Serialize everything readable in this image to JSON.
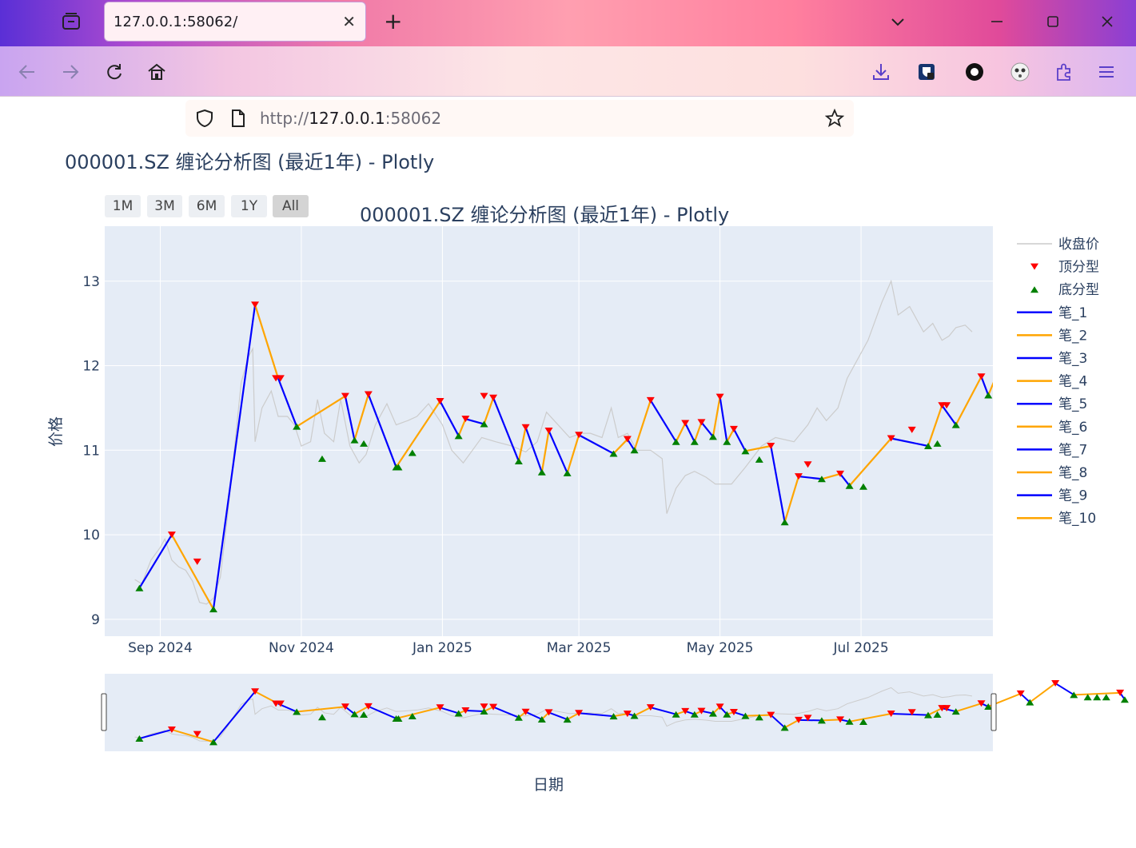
{
  "browser": {
    "tab_title": "127.0.0.1:58062/",
    "tab_close": "✕",
    "new_tab": "+",
    "url_scheme": "http://",
    "url_host": "127.0.0.1",
    "url_port": ":58062"
  },
  "page": {
    "title": "000001.SZ 缠论分析图 (最近1年) - Plotly"
  },
  "range_buttons": [
    "1M",
    "3M",
    "6M",
    "1Y",
    "All"
  ],
  "range_active": "All",
  "colors": {
    "plot_bg": "#e5ecf6",
    "close": "#cccccc",
    "top": "#ff0000",
    "bottom": "#008000",
    "bi_odd": "#0000ff",
    "bi_even": "#ffa500",
    "text": "#2a3f5f"
  },
  "chart_data": {
    "type": "line",
    "title": "000001.SZ 缠论分析图 (最近1年) - Plotly",
    "xlabel": "日期",
    "ylabel": "价格",
    "x_ticks": [
      "Sep 2024",
      "Nov 2024",
      "Jan 2025",
      "Mar 2025",
      "May 2025",
      "Jul 2025"
    ],
    "x_tick_dates": [
      "2024-09-01",
      "2024-11-01",
      "2025-01-01",
      "2025-03-01",
      "2025-05-01",
      "2025-07-01"
    ],
    "y_ticks": [
      9,
      10,
      11,
      12,
      13
    ],
    "xlim": [
      "2024-08-08",
      "2025-08-27"
    ],
    "ylim": [
      8.8,
      13.65
    ],
    "legend": [
      "收盘价",
      "顶分型",
      "底分型",
      "笔_1",
      "笔_2",
      "笔_3",
      "笔_4",
      "笔_5",
      "笔_6",
      "笔_7",
      "笔_8",
      "笔_9",
      "笔_10"
    ],
    "legend_position": "right",
    "close": [
      [
        "2024-08-21",
        9.47
      ],
      [
        "2024-08-24",
        9.42
      ],
      [
        "2024-08-28",
        9.7
      ],
      [
        "2024-09-01",
        9.85
      ],
      [
        "2024-09-03",
        9.95
      ],
      [
        "2024-09-06",
        9.7
      ],
      [
        "2024-09-09",
        9.62
      ],
      [
        "2024-09-12",
        9.58
      ],
      [
        "2024-09-15",
        9.45
      ],
      [
        "2024-09-18",
        9.2
      ],
      [
        "2024-09-21",
        9.18
      ],
      [
        "2024-09-24",
        9.25
      ],
      [
        "2024-09-27",
        9.5
      ],
      [
        "2024-09-30",
        10.2
      ],
      [
        "2024-10-03",
        11.0
      ],
      [
        "2024-10-06",
        11.8
      ],
      [
        "2024-10-09",
        12.1
      ],
      [
        "2024-10-11",
        12.2
      ],
      [
        "2024-10-12",
        11.1
      ],
      [
        "2024-10-15",
        11.5
      ],
      [
        "2024-10-19",
        11.7
      ],
      [
        "2024-10-22",
        11.4
      ],
      [
        "2024-10-26",
        11.4
      ],
      [
        "2024-10-29",
        11.3
      ],
      [
        "2024-11-01",
        11.05
      ],
      [
        "2024-11-05",
        11.1
      ],
      [
        "2024-11-08",
        11.6
      ],
      [
        "2024-11-11",
        11.2
      ],
      [
        "2024-11-15",
        11.1
      ],
      [
        "2024-11-18",
        11.6
      ],
      [
        "2024-11-22",
        11.05
      ],
      [
        "2024-11-26",
        10.85
      ],
      [
        "2024-11-29",
        10.95
      ],
      [
        "2024-12-03",
        11.3
      ],
      [
        "2024-12-08",
        11.55
      ],
      [
        "2024-12-12",
        11.3
      ],
      [
        "2024-12-17",
        11.35
      ],
      [
        "2024-12-21",
        11.4
      ],
      [
        "2024-12-26",
        11.55
      ],
      [
        "2025-01-01",
        11.3
      ],
      [
        "2025-01-05",
        11.0
      ],
      [
        "2025-01-10",
        10.85
      ],
      [
        "2025-01-14",
        11.0
      ],
      [
        "2025-01-18",
        11.15
      ],
      [
        "2025-01-24",
        11.1
      ],
      [
        "2025-01-31",
        11.05
      ],
      [
        "2025-02-06",
        10.98
      ],
      [
        "2025-02-11",
        11.1
      ],
      [
        "2025-02-15",
        11.45
      ],
      [
        "2025-02-20",
        11.3
      ],
      [
        "2025-02-25",
        11.15
      ],
      [
        "2025-03-02",
        11.2
      ],
      [
        "2025-03-06",
        11.2
      ],
      [
        "2025-03-11",
        11.15
      ],
      [
        "2025-03-15",
        11.5
      ],
      [
        "2025-03-18",
        11.15
      ],
      [
        "2025-03-22",
        11.2
      ],
      [
        "2025-03-26",
        11.0
      ],
      [
        "2025-04-01",
        11.0
      ],
      [
        "2025-04-06",
        10.9
      ],
      [
        "2025-04-08",
        10.25
      ],
      [
        "2025-04-12",
        10.55
      ],
      [
        "2025-04-16",
        10.7
      ],
      [
        "2025-04-20",
        10.75
      ],
      [
        "2025-04-25",
        10.68
      ],
      [
        "2025-04-29",
        10.6
      ],
      [
        "2025-05-06",
        10.6
      ],
      [
        "2025-05-12",
        10.8
      ],
      [
        "2025-05-19",
        11.05
      ],
      [
        "2025-05-25",
        11.15
      ],
      [
        "2025-06-02",
        11.1
      ],
      [
        "2025-06-08",
        11.3
      ],
      [
        "2025-06-12",
        11.5
      ],
      [
        "2025-06-16",
        11.35
      ],
      [
        "2025-06-21",
        11.5
      ],
      [
        "2025-06-25",
        11.85
      ],
      [
        "2025-06-30",
        12.1
      ],
      [
        "2025-07-04",
        12.3
      ],
      [
        "2025-07-10",
        12.75
      ],
      [
        "2025-07-14",
        13.0
      ],
      [
        "2025-07-17",
        12.6
      ],
      [
        "2025-07-22",
        12.7
      ],
      [
        "2025-07-25",
        12.55
      ],
      [
        "2025-07-28",
        12.4
      ],
      [
        "2025-08-01",
        12.5
      ],
      [
        "2025-08-05",
        12.3
      ],
      [
        "2025-08-08",
        12.35
      ],
      [
        "2025-08-11",
        12.45
      ],
      [
        "2025-08-15",
        12.48
      ],
      [
        "2025-08-18",
        12.4
      ]
    ],
    "bi_points": [
      [
        "2024-08-23",
        9.37
      ],
      [
        "2024-09-06",
        10.0
      ],
      [
        "2024-09-24",
        9.12
      ],
      [
        "2024-10-12",
        12.72
      ],
      [
        "2024-10-22",
        11.85
      ],
      [
        "2024-10-30",
        11.28
      ],
      [
        "2024-11-20",
        11.64
      ],
      [
        "2024-11-24",
        11.12
      ],
      [
        "2024-11-30",
        11.66
      ],
      [
        "2024-12-12",
        10.8
      ],
      [
        "2024-12-31",
        11.58
      ],
      [
        "2025-01-08",
        11.17
      ],
      [
        "2025-01-11",
        11.37
      ],
      [
        "2025-01-19",
        11.31
      ],
      [
        "2025-01-23",
        11.62
      ],
      [
        "2025-02-03",
        10.87
      ],
      [
        "2025-02-06",
        11.27
      ],
      [
        "2025-02-13",
        10.74
      ],
      [
        "2025-02-16",
        11.23
      ],
      [
        "2025-02-24",
        10.73
      ],
      [
        "2025-02-29",
        11.18
      ],
      [
        "2025-03-16",
        10.96
      ],
      [
        "2025-03-22",
        11.13
      ],
      [
        "2025-03-25",
        11.0
      ],
      [
        "2025-04-01",
        11.59
      ],
      [
        "2025-04-12",
        11.1
      ],
      [
        "2025-04-16",
        11.32
      ],
      [
        "2025-04-20",
        11.1
      ],
      [
        "2025-04-23",
        11.33
      ],
      [
        "2025-04-28",
        11.16
      ],
      [
        "2025-04-31",
        11.63
      ],
      [
        "2025-05-04",
        11.1
      ],
      [
        "2025-05-07",
        11.25
      ],
      [
        "2025-05-12",
        10.99
      ],
      [
        "2025-05-23",
        11.05
      ],
      [
        "2025-05-29",
        10.15
      ],
      [
        "2025-06-04",
        10.69
      ],
      [
        "2025-06-14",
        10.66
      ],
      [
        "2025-06-22",
        10.72
      ],
      [
        "2025-06-26",
        10.58
      ],
      [
        "2025-07-14",
        11.14
      ],
      [
        "2025-07-30",
        11.05
      ],
      [
        "2025-08-05",
        11.53
      ],
      [
        "2025-08-11",
        11.3
      ],
      [
        "2025-08-22",
        11.87
      ],
      [
        "2025-08-25",
        11.65
      ],
      [
        "2025-09-08",
        12.57
      ],
      [
        "2025-09-12",
        11.96
      ],
      [
        "2025-09-23",
        13.31
      ],
      [
        "2025-10-01",
        12.49
      ],
      [
        "2025-10-21",
        12.63
      ],
      [
        "2025-10-23",
        12.15
      ]
    ],
    "top_fractals": [
      [
        "2024-09-06",
        10.0
      ],
      [
        "2024-09-17",
        9.68
      ],
      [
        "2024-10-12",
        12.72
      ],
      [
        "2024-10-21",
        11.85
      ],
      [
        "2024-10-23",
        11.85
      ],
      [
        "2024-11-20",
        11.64
      ],
      [
        "2024-11-30",
        11.66
      ],
      [
        "2024-12-31",
        11.58
      ],
      [
        "2025-01-11",
        11.37
      ],
      [
        "2025-01-19",
        11.64
      ],
      [
        "2025-01-23",
        11.62
      ],
      [
        "2025-02-06",
        11.27
      ],
      [
        "2025-02-16",
        11.23
      ],
      [
        "2025-02-29",
        11.18
      ],
      [
        "2025-03-22",
        11.13
      ],
      [
        "2025-04-01",
        11.59
      ],
      [
        "2025-04-16",
        11.32
      ],
      [
        "2025-04-23",
        11.33
      ],
      [
        "2025-04-31",
        11.63
      ],
      [
        "2025-05-07",
        11.25
      ],
      [
        "2025-05-23",
        11.05
      ],
      [
        "2025-06-04",
        10.69
      ],
      [
        "2025-06-08",
        10.83
      ],
      [
        "2025-06-22",
        10.72
      ],
      [
        "2025-07-14",
        11.14
      ],
      [
        "2025-07-23",
        11.24
      ],
      [
        "2025-08-05",
        11.53
      ],
      [
        "2025-08-07",
        11.53
      ],
      [
        "2025-08-22",
        11.87
      ],
      [
        "2025-09-08",
        12.57
      ],
      [
        "2025-09-23",
        13.31
      ],
      [
        "2025-10-21",
        12.63
      ]
    ],
    "bottom_fractals": [
      [
        "2024-08-23",
        9.37
      ],
      [
        "2024-09-24",
        9.12
      ],
      [
        "2024-10-30",
        11.28
      ],
      [
        "2024-11-10",
        10.9
      ],
      [
        "2024-11-24",
        11.12
      ],
      [
        "2024-11-28",
        11.08
      ],
      [
        "2024-12-12",
        10.8
      ],
      [
        "2024-12-13",
        10.8
      ],
      [
        "2024-12-19",
        10.97
      ],
      [
        "2025-01-08",
        11.17
      ],
      [
        "2025-01-19",
        11.31
      ],
      [
        "2025-02-03",
        10.87
      ],
      [
        "2025-02-13",
        10.74
      ],
      [
        "2025-02-24",
        10.73
      ],
      [
        "2025-03-16",
        10.96
      ],
      [
        "2025-03-25",
        11.0
      ],
      [
        "2025-04-12",
        11.1
      ],
      [
        "2025-04-20",
        11.1
      ],
      [
        "2025-04-28",
        11.16
      ],
      [
        "2025-05-04",
        11.1
      ],
      [
        "2025-05-12",
        10.99
      ],
      [
        "2025-05-18",
        10.89
      ],
      [
        "2025-05-29",
        10.15
      ],
      [
        "2025-06-14",
        10.66
      ],
      [
        "2025-06-26",
        10.58
      ],
      [
        "2025-07-02",
        10.57
      ],
      [
        "2025-07-30",
        11.05
      ],
      [
        "2025-08-03",
        11.08
      ],
      [
        "2025-08-11",
        11.3
      ],
      [
        "2025-08-25",
        11.65
      ],
      [
        "2025-09-12",
        11.96
      ],
      [
        "2025-10-01",
        12.49
      ],
      [
        "2025-10-07",
        12.32
      ],
      [
        "2025-10-11",
        12.32
      ],
      [
        "2025-10-15",
        12.32
      ],
      [
        "2025-10-23",
        12.15
      ]
    ]
  }
}
